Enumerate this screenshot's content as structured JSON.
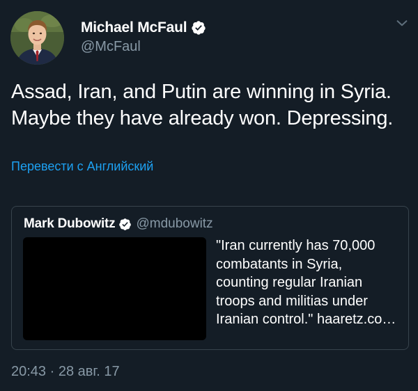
{
  "tweet": {
    "author": {
      "display_name": "Michael McFaul",
      "handle": "@McFaul",
      "verified": true,
      "avatar_icon": "profile-photo"
    },
    "text": "Assad, Iran, and Putin are winning in Syria. Maybe they have already won. Depressing.",
    "translate_label": "Перевести с Английский",
    "timestamp": "20:43 · 28 авг. 17",
    "menu_icon": "chevron-down-icon"
  },
  "quoted_tweet": {
    "display_name": "Mark Dubowitz",
    "handle": "@mdubowitz",
    "verified": true,
    "text": "\"Iran currently has 70,000\ncombatants in Syria,\ncounting regular Iranian\ntroops and militias under\nIranian control.\" haaretz.co…"
  },
  "colors": {
    "background": "#141d26",
    "text_primary": "#ffffff",
    "text_secondary": "#8899a6",
    "link": "#1da1f2",
    "border": "#38444d"
  }
}
